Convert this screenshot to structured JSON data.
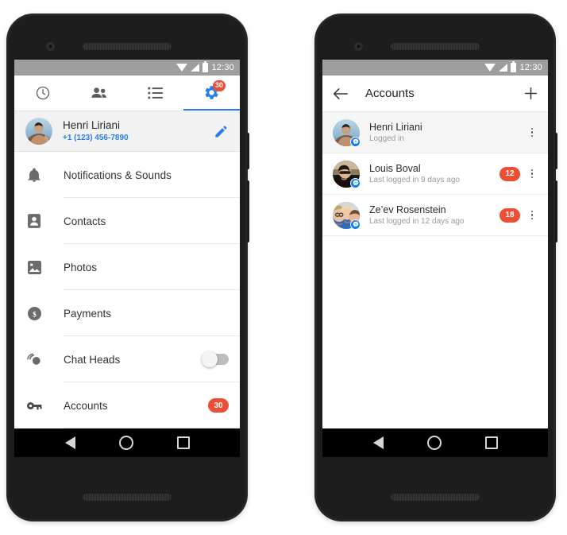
{
  "status_bar": {
    "time": "12:30",
    "icons": [
      "wifi-icon",
      "signal-icon",
      "battery-icon"
    ]
  },
  "colors": {
    "accent_blue": "#2b7de9",
    "badge_red": "#eb5037",
    "messenger_blue": "#0a7cff",
    "status_bar_gray": "#9e9e9e",
    "row_active_gray": "#f5f5f5"
  },
  "left_phone": {
    "tabs": [
      {
        "name": "recent-tab",
        "icon": "clock-icon",
        "active": false,
        "badge": ""
      },
      {
        "name": "people-tab",
        "icon": "people-icon",
        "active": false,
        "badge": ""
      },
      {
        "name": "groups-tab",
        "icon": "list-icon",
        "active": false,
        "badge": ""
      },
      {
        "name": "settings-tab",
        "icon": "gear-icon",
        "active": true,
        "badge": "30"
      }
    ],
    "profile": {
      "name": "Henri Liriani",
      "phone": "+1 (123) 456-7890",
      "edit_icon": "pencil-icon"
    },
    "settings_items": [
      {
        "label": "Notifications & Sounds",
        "icon": "bell-icon",
        "control": "none"
      },
      {
        "label": "Contacts",
        "icon": "contact-icon",
        "control": "none"
      },
      {
        "label": "Photos",
        "icon": "photo-icon",
        "control": "none"
      },
      {
        "label": "Payments",
        "icon": "dollar-icon",
        "control": "none"
      },
      {
        "label": "Chat Heads",
        "icon": "chathead-icon",
        "control": "toggle",
        "toggle_on": false
      },
      {
        "label": "Accounts",
        "icon": "key-icon",
        "control": "badge",
        "badge": "30"
      }
    ]
  },
  "right_phone": {
    "appbar": {
      "back_icon": "arrow-left-icon",
      "title": "Accounts",
      "add_icon": "plus-icon"
    },
    "accounts": [
      {
        "name": "Henri Liriani",
        "status": "Logged in",
        "badge": "",
        "active": true,
        "avatar": "avatar-henri",
        "menu_icon": "kebab-menu-icon"
      },
      {
        "name": "Louis Boval",
        "status": "Last logged in 9 days ago",
        "badge": "12",
        "active": false,
        "avatar": "avatar-louis",
        "menu_icon": "kebab-menu-icon"
      },
      {
        "name": "Ze’ev Rosenstein",
        "status": "Last logged in 12 days ago",
        "badge": "18",
        "active": false,
        "avatar": "avatar-zeev",
        "menu_icon": "kebab-menu-icon"
      }
    ]
  },
  "nav_bar": {
    "back": "back-triangle-icon",
    "home": "home-circle-icon",
    "recents": "recents-square-icon"
  }
}
